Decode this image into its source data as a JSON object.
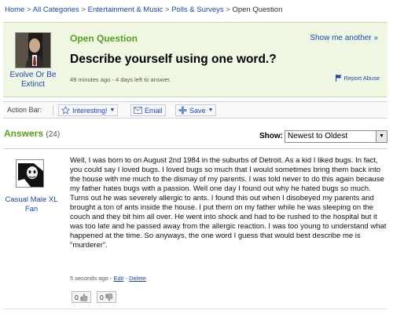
{
  "breadcrumb": {
    "home": "Home",
    "all_categories": "All Categories",
    "entertainment": "Entertainment & Music",
    "polls": "Polls & Surveys",
    "current": "Open Question",
    "separator": ">"
  },
  "question": {
    "status": "Open Question",
    "title": "Describe yourself using one word.?",
    "meta": "49 minutes ago - 4 days left to answer.",
    "show_more": "Show me another »",
    "report_abuse": "Report Abuse",
    "asker_name": "Evolve Or Be Extinct"
  },
  "action_bar": {
    "label": "Action Bar:",
    "interesting": "Interesting!",
    "email": "Email",
    "save": "Save"
  },
  "answers": {
    "title": "Answers",
    "count": "(24)",
    "show_label": "Show:",
    "sort_selected": "Newest to Oldest"
  },
  "answer": {
    "author": "Casual Male XL Fan",
    "text": "Well, I was born to on August 2nd 1984 in the suburbs of Detroit. As a kid I liked bugs. In fact, you could say I loved bugs. I loved bugs so much that I would sometimes bring them back into the house with me much to the dismay of my parents. I was told never to do this again because my father hates bugs with a passion. Well one day I found out why he hated bugs so much. Turns out he was severely allergic to ants. I found this out when I disobeyed my parents and brought a ton of ants inside the house. I put them on my father while he was sleeping on the couch and they bit him all over. He went into shock and had to be rushed to the hospital but it was too late and he passed away from the allergic reaction. I was too young to understand what happened at the time. So anyways, the one word I guess that would best describe me is \"murderer\".",
    "time": "5 seconds ago -",
    "edit": "Edit",
    "dash": "-",
    "delete": "Delete",
    "thumbs_up": "0",
    "thumbs_down": "0"
  },
  "colors": {
    "green": "#5a9f1f",
    "link": "#1a47b8",
    "question_bg": "#f0f8e4"
  }
}
